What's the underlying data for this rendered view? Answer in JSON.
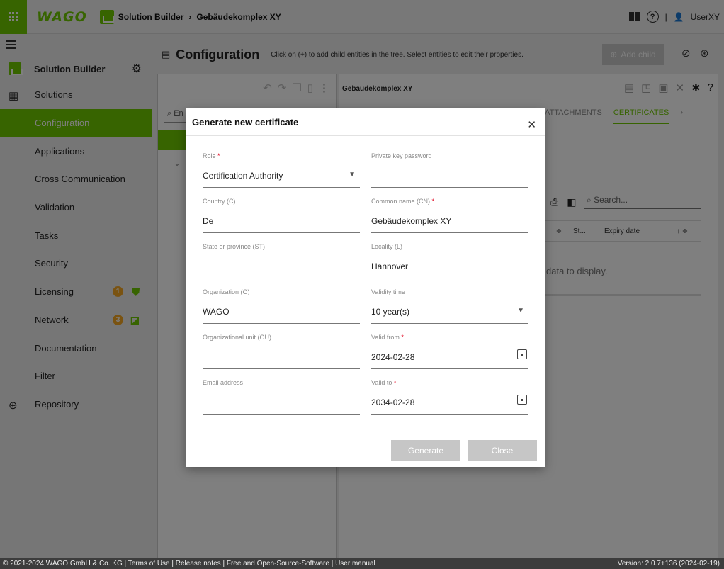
{
  "header": {
    "logo": "WAGO",
    "crumbs": [
      "Solution Builder",
      "Gebäudekomplex XY"
    ],
    "user": "UserXY"
  },
  "sidebar": {
    "title": "Solution Builder",
    "items": [
      {
        "label": "Solutions"
      },
      {
        "label": "Configuration"
      },
      {
        "label": "Applications"
      },
      {
        "label": "Cross Communication"
      },
      {
        "label": "Validation"
      },
      {
        "label": "Tasks"
      },
      {
        "label": "Security"
      },
      {
        "label": "Licensing",
        "badge": "1"
      },
      {
        "label": "Network",
        "badge": "3"
      },
      {
        "label": "Documentation"
      },
      {
        "label": "Filter"
      },
      {
        "label": "Repository"
      }
    ]
  },
  "main": {
    "title": "Configuration",
    "hint": "Click on (+) to add child entities in the tree. Select entities to edit their properties.",
    "add_child": "Add child",
    "tree_search_placeholder": "En",
    "detail_title": "Gebäudekomplex XY",
    "tabs": [
      "ATTACHMENTS",
      "CERTIFICATES"
    ],
    "grid_search_placeholder": "Search...",
    "grid_cols": [
      "St...",
      "Expiry date"
    ],
    "empty_text": "data to display."
  },
  "dialog": {
    "title": "Generate new certificate",
    "fields": {
      "role": {
        "label": "Role",
        "value": "Certification Authority"
      },
      "private_key": {
        "label": "Private key password",
        "value": ""
      },
      "country": {
        "label": "Country (C)",
        "value": "De"
      },
      "common_name": {
        "label": "Common name (CN)",
        "value": "Gebäudekomplex XY"
      },
      "state": {
        "label": "State or province (ST)",
        "value": ""
      },
      "locality": {
        "label": "Locality (L)",
        "value": "Hannover"
      },
      "organization": {
        "label": "Organization (O)",
        "value": "WAGO"
      },
      "validity": {
        "label": "Validity time",
        "value": "10 year(s)"
      },
      "org_unit": {
        "label": "Organizational unit (OU)",
        "value": ""
      },
      "valid_from": {
        "label": "Valid from",
        "value": "2024-02-28"
      },
      "email": {
        "label": "Email address",
        "value": ""
      },
      "valid_to": {
        "label": "Valid to",
        "value": "2034-02-28"
      }
    },
    "generate_label": "Generate",
    "close_label": "Close"
  },
  "footer": {
    "text": "© 2021-2024 WAGO GmbH & Co. KG | Terms of Use | Release notes | Free and Open-Source-Software | User manual",
    "version": "Version: 2.0.7+136 (2024-02-19)"
  },
  "colors": {
    "accent": "#6ec800",
    "badge": "#f5a623",
    "required": "#e0001b"
  }
}
